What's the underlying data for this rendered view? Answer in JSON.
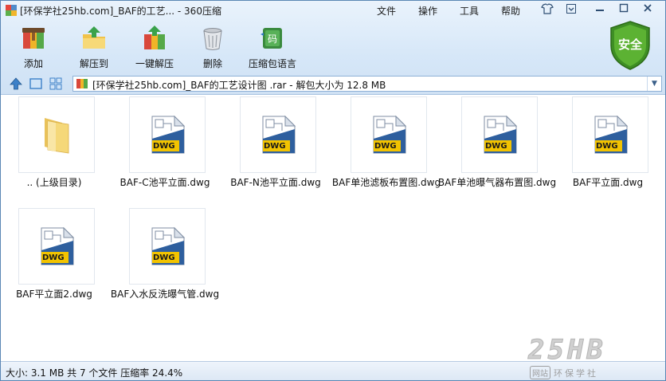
{
  "window": {
    "title": "[环保学社25hb.com]_BAF的工艺... - 360压缩"
  },
  "menu": {
    "items": [
      "文件",
      "操作",
      "工具",
      "帮助"
    ]
  },
  "toolbar": {
    "tools": [
      {
        "label": "添加",
        "icon": "add-archive-icon"
      },
      {
        "label": "解压到",
        "icon": "extract-to-folder-icon"
      },
      {
        "label": "一键解压",
        "icon": "one-click-extract-icon"
      },
      {
        "label": "删除",
        "icon": "trash-icon"
      },
      {
        "label": "压缩包语言",
        "icon": "archive-language-icon"
      }
    ],
    "security_badge": "安全"
  },
  "address": {
    "path": "[环保学社25hb.com]_BAF的工艺设计图 .rar - 解包大小为 12.8 MB"
  },
  "files": [
    {
      "name": ".. (上级目录)",
      "type": "parent-folder"
    },
    {
      "name": "BAF-C池平立面.dwg",
      "type": "dwg"
    },
    {
      "name": "BAF-N池平立面.dwg",
      "type": "dwg"
    },
    {
      "name": "BAF单池滤板布置图.dwg",
      "type": "dwg"
    },
    {
      "name": "BAF单池曝气器布置图.dwg",
      "type": "dwg"
    },
    {
      "name": "BAF平立面.dwg",
      "type": "dwg"
    },
    {
      "name": "BAF平立面2.dwg",
      "type": "dwg"
    },
    {
      "name": "BAF入水反洗曝气管.dwg",
      "type": "dwg"
    }
  ],
  "dwg_badge": "DWG",
  "status": {
    "text": "大小: 3.1 MB 共 7 个文件 压缩率 24.4%"
  },
  "watermark": {
    "brand": "25HB",
    "tag": "网站",
    "text": "环保学社"
  },
  "colors": {
    "chrome_blue": "#d6e7f8",
    "shield_green": "#4a9a2a",
    "dwg_yellow": "#f2c300",
    "dwg_blue": "#2e5f9e",
    "folder_yellow": "#f5d879"
  }
}
